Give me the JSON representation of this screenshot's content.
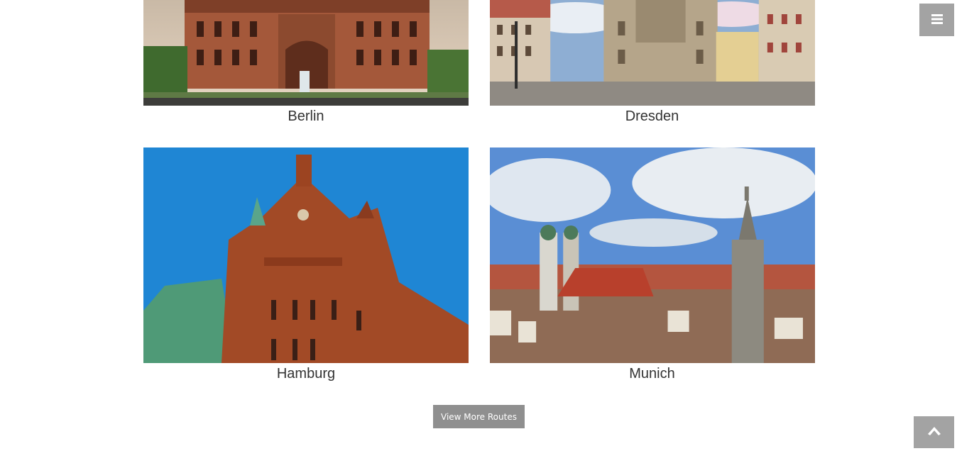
{
  "cities": [
    {
      "name": "Berlin",
      "image_alt": "Berlin Cathedral"
    },
    {
      "name": "Dresden",
      "image_alt": "Dresden Neumarkt with Frauenkirche"
    },
    {
      "name": "Hamburg",
      "image_alt": "Hamburg Speicherstadt brick building"
    },
    {
      "name": "Munich",
      "image_alt": "Munich skyline with Frauenkirche and Town Hall"
    }
  ],
  "view_more_label": "View More Routes",
  "icons": {
    "menu": "hamburger-menu-icon",
    "scroll_top": "arrow-up-icon"
  },
  "colors": {
    "button_gray": "#8f8f8f",
    "toggle_gray": "#a3a3a3",
    "text": "#333333"
  }
}
